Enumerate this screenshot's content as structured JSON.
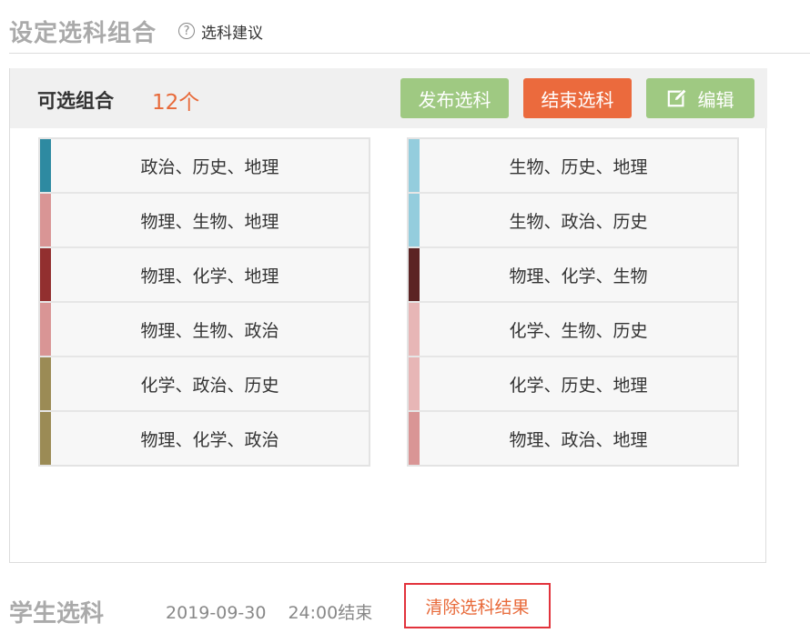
{
  "header": {
    "title": "设定选科组合",
    "help_link": "选科建议",
    "help_icon": "question-circle-icon"
  },
  "panel": {
    "title": "可选组合",
    "count": "12个",
    "buttons": {
      "publish": "发布选科",
      "end": "结束选科",
      "edit": "编辑"
    },
    "colors": {
      "publish_bg": "#9fc982",
      "end_bg": "#eb6a3d",
      "edit_bg": "#9fc982",
      "count_color": "#e86a3a"
    },
    "left_combos": [
      {
        "label": "政治、历史、地理",
        "color": "#2e8aa1"
      },
      {
        "label": "物理、生物、地理",
        "color": "#d99595"
      },
      {
        "label": "物理、化学、地理",
        "color": "#922f2f"
      },
      {
        "label": "物理、生物、政治",
        "color": "#d99595"
      },
      {
        "label": "化学、政治、历史",
        "color": "#9b8b55"
      },
      {
        "label": "物理、化学、政治",
        "color": "#9b8b55"
      }
    ],
    "right_combos": [
      {
        "label": "生物、历史、地理",
        "color": "#94cddd"
      },
      {
        "label": "生物、政治、历史",
        "color": "#94cddd"
      },
      {
        "label": "物理、化学、生物",
        "color": "#5c2323"
      },
      {
        "label": "化学、生物、历史",
        "color": "#e7b6b6"
      },
      {
        "label": "化学、历史、地理",
        "color": "#e7b6b6"
      },
      {
        "label": "物理、政治、地理",
        "color": "#d99595"
      }
    ]
  },
  "student": {
    "title": "学生选科",
    "date": "2019-09-30",
    "time_end": "24:00结束",
    "clear_button": "清除选科结果"
  }
}
